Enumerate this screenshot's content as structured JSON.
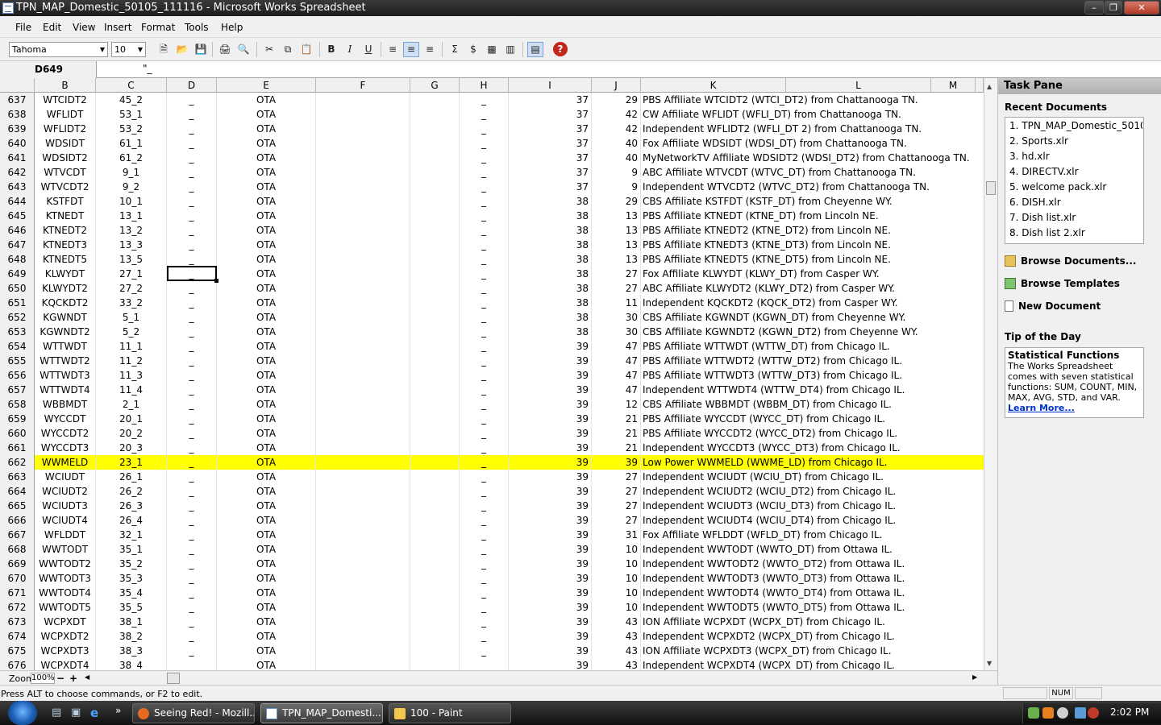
{
  "window": {
    "title": "TPN_MAP_Domestic_50105_111116 - Microsoft Works Spreadsheet"
  },
  "menu": [
    "File",
    "Edit",
    "View",
    "Insert",
    "Format",
    "Tools",
    "Help"
  ],
  "toolbar": {
    "font": "Tahoma",
    "size": "10"
  },
  "formula": {
    "cell_ref": "D649",
    "content": "\"_"
  },
  "columns": [
    "B",
    "C",
    "D",
    "E",
    "F",
    "G",
    "H",
    "I",
    "J",
    "K",
    "L",
    "M"
  ],
  "rows": [
    [
      "637",
      "WTCIDT2",
      "45_2",
      "_",
      "OTA",
      "_",
      "37",
      "29",
      "PBS Affiliate WTCIDT2 (WTCI_DT2) from Chattanooga TN."
    ],
    [
      "638",
      "WFLIDT",
      "53_1",
      "_",
      "OTA",
      "_",
      "37",
      "42",
      "CW Affiliate WFLIDT (WFLI_DT) from Chattanooga TN."
    ],
    [
      "639",
      "WFLIDT2",
      "53_2",
      "_",
      "OTA",
      "_",
      "37",
      "42",
      "Independent WFLIDT2 (WFLI_DT 2) from Chattanooga TN."
    ],
    [
      "640",
      "WDSIDT",
      "61_1",
      "_",
      "OTA",
      "_",
      "37",
      "40",
      "Fox Affiliate WDSIDT (WDSI_DT) from Chattanooga TN."
    ],
    [
      "641",
      "WDSIDT2",
      "61_2",
      "_",
      "OTA",
      "_",
      "37",
      "40",
      "MyNetworkTV Affiliate WDSIDT2 (WDSI_DT2) from Chattanooga TN."
    ],
    [
      "642",
      "WTVCDT",
      "9_1",
      "_",
      "OTA",
      "_",
      "37",
      "9",
      "ABC Affiliate WTVCDT (WTVC_DT) from Chattanooga TN."
    ],
    [
      "643",
      "WTVCDT2",
      "9_2",
      "_",
      "OTA",
      "_",
      "37",
      "9",
      "Independent WTVCDT2 (WTVC_DT2) from Chattanooga TN."
    ],
    [
      "644",
      "KSTFDT",
      "10_1",
      "_",
      "OTA",
      "_",
      "38",
      "29",
      "CBS Affiliate KSTFDT (KSTF_DT) from Cheyenne WY."
    ],
    [
      "645",
      "KTNEDT",
      "13_1",
      "_",
      "OTA",
      "_",
      "38",
      "13",
      "PBS Affiliate KTNEDT (KTNE_DT) from Lincoln NE."
    ],
    [
      "646",
      "KTNEDT2",
      "13_2",
      "_",
      "OTA",
      "_",
      "38",
      "13",
      "PBS Affiliate KTNEDT2 (KTNE_DT2) from Lincoln NE."
    ],
    [
      "647",
      "KTNEDT3",
      "13_3",
      "_",
      "OTA",
      "_",
      "38",
      "13",
      "PBS Affiliate KTNEDT3 (KTNE_DT3) from Lincoln NE."
    ],
    [
      "648",
      "KTNEDT5",
      "13_5",
      "_",
      "OTA",
      "_",
      "38",
      "13",
      "PBS Affiliate KTNEDT5 (KTNE_DT5) from Lincoln NE."
    ],
    [
      "649",
      "KLWYDT",
      "27_1",
      "_",
      "OTA",
      "_",
      "38",
      "27",
      "Fox Affiliate KLWYDT (KLWY_DT) from Casper WY."
    ],
    [
      "650",
      "KLWYDT2",
      "27_2",
      "_",
      "OTA",
      "_",
      "38",
      "27",
      "ABC Affiliate KLWYDT2 (KLWY_DT2) from Casper WY."
    ],
    [
      "651",
      "KQCKDT2",
      "33_2",
      "_",
      "OTA",
      "_",
      "38",
      "11",
      "Independent KQCKDT2 (KQCK_DT2) from Casper WY."
    ],
    [
      "652",
      "KGWNDT",
      "5_1",
      "_",
      "OTA",
      "_",
      "38",
      "30",
      "CBS Affiliate KGWNDT (KGWN_DT) from Cheyenne WY."
    ],
    [
      "653",
      "KGWNDT2",
      "5_2",
      "_",
      "OTA",
      "_",
      "38",
      "30",
      "CBS Affiliate KGWNDT2 (KGWN_DT2) from Cheyenne WY."
    ],
    [
      "654",
      "WTTWDT",
      "11_1",
      "_",
      "OTA",
      "_",
      "39",
      "47",
      "PBS Affiliate WTTWDT (WTTW_DT) from Chicago IL."
    ],
    [
      "655",
      "WTTWDT2",
      "11_2",
      "_",
      "OTA",
      "_",
      "39",
      "47",
      "PBS Affiliate WTTWDT2 (WTTW_DT2) from Chicago IL."
    ],
    [
      "656",
      "WTTWDT3",
      "11_3",
      "_",
      "OTA",
      "_",
      "39",
      "47",
      "PBS Affiliate WTTWDT3 (WTTW_DT3) from Chicago IL."
    ],
    [
      "657",
      "WTTWDT4",
      "11_4",
      "_",
      "OTA",
      "_",
      "39",
      "47",
      "Independent WTTWDT4 (WTTW_DT4) from Chicago IL."
    ],
    [
      "658",
      "WBBMDT",
      "2_1",
      "_",
      "OTA",
      "_",
      "39",
      "12",
      "CBS Affiliate WBBMDT (WBBM_DT) from Chicago IL."
    ],
    [
      "659",
      "WYCCDT",
      "20_1",
      "_",
      "OTA",
      "_",
      "39",
      "21",
      "PBS Affiliate WYCCDT (WYCC_DT) from Chicago IL."
    ],
    [
      "660",
      "WYCCDT2",
      "20_2",
      "_",
      "OTA",
      "_",
      "39",
      "21",
      "PBS Affiliate WYCCDT2 (WYCC_DT2) from Chicago IL."
    ],
    [
      "661",
      "WYCCDT3",
      "20_3",
      "_",
      "OTA",
      "_",
      "39",
      "21",
      "Independent WYCCDT3 (WYCC_DT3) from Chicago IL."
    ],
    [
      "662",
      "WWMELD",
      "23_1",
      "_",
      "OTA",
      "_",
      "39",
      "39",
      "Low Power WWMELD (WWME_LD) from Chicago IL."
    ],
    [
      "663",
      "WCIUDT",
      "26_1",
      "_",
      "OTA",
      "_",
      "39",
      "27",
      "Independent WCIUDT (WCIU_DT) from Chicago IL."
    ],
    [
      "664",
      "WCIUDT2",
      "26_2",
      "_",
      "OTA",
      "_",
      "39",
      "27",
      "Independent WCIUDT2 (WCIU_DT2) from Chicago IL."
    ],
    [
      "665",
      "WCIUDT3",
      "26_3",
      "_",
      "OTA",
      "_",
      "39",
      "27",
      "Independent WCIUDT3 (WCIU_DT3) from Chicago IL."
    ],
    [
      "666",
      "WCIUDT4",
      "26_4",
      "_",
      "OTA",
      "_",
      "39",
      "27",
      "Independent WCIUDT4 (WCIU_DT4) from Chicago IL."
    ],
    [
      "667",
      "WFLDDT",
      "32_1",
      "_",
      "OTA",
      "_",
      "39",
      "31",
      "Fox Affiliate WFLDDT (WFLD_DT) from Chicago IL."
    ],
    [
      "668",
      "WWTODT",
      "35_1",
      "_",
      "OTA",
      "_",
      "39",
      "10",
      "Independent WWTODT (WWTO_DT) from Ottawa IL."
    ],
    [
      "669",
      "WWTODT2",
      "35_2",
      "_",
      "OTA",
      "_",
      "39",
      "10",
      "Independent WWTODT2 (WWTO_DT2) from Ottawa IL."
    ],
    [
      "670",
      "WWTODT3",
      "35_3",
      "_",
      "OTA",
      "_",
      "39",
      "10",
      "Independent WWTODT3 (WWTO_DT3) from Ottawa IL."
    ],
    [
      "671",
      "WWTODT4",
      "35_4",
      "_",
      "OTA",
      "_",
      "39",
      "10",
      "Independent WWTODT4 (WWTO_DT4) from Ottawa IL."
    ],
    [
      "672",
      "WWTODT5",
      "35_5",
      "_",
      "OTA",
      "_",
      "39",
      "10",
      "Independent WWTODT5 (WWTO_DT5) from Ottawa IL."
    ],
    [
      "673",
      "WCPXDT",
      "38_1",
      "_",
      "OTA",
      "_",
      "39",
      "43",
      "ION Affiliate WCPXDT (WCPX_DT) from Chicago IL."
    ],
    [
      "674",
      "WCPXDT2",
      "38_2",
      "_",
      "OTA",
      "_",
      "39",
      "43",
      "Independent WCPXDT2 (WCPX_DT) from Chicago IL."
    ],
    [
      "675",
      "WCPXDT3",
      "38_3",
      "_",
      "OTA",
      "_",
      "39",
      "43",
      "ION Affiliate WCPXDT3 (WCPX_DT) from Chicago IL."
    ],
    [
      "676",
      "WCPXDT4",
      "38_4",
      "_",
      "OTA",
      "_",
      "39",
      "43",
      "Independent WCPXDT4 (WCPX_DT) from Chicago IL."
    ]
  ],
  "highlight_row": "662",
  "highlight_color": "#ffff00",
  "selected_cell": "D649",
  "zoom": {
    "label": "Zoom",
    "value": "100%"
  },
  "taskpane": {
    "title": "Task Pane",
    "recent_title": "Recent Documents",
    "recent": [
      "1. TPN_MAP_Domestic_5010...",
      "2. Sports.xlr",
      "3. hd.xlr",
      "4. DIRECTV.xlr",
      "5. welcome pack.xlr",
      "6. DISH.xlr",
      "7. Dish list.xlr",
      "8. Dish list 2.xlr"
    ],
    "browse_documents": "Browse Documents...",
    "browse_templates": "Browse Templates",
    "new_document": "New Document",
    "tip_title": "Tip of the Day",
    "tip_heading": "Statistical Functions",
    "tip_body": "The Works Spreadsheet comes with seven statistical functions: SUM, COUNT, MIN, MAX, AVG, STD, and VAR.",
    "tip_link": "Learn More..."
  },
  "status": {
    "message": "Press ALT to choose commands, or F2 to edit.",
    "num": "NUM"
  },
  "taskbar": {
    "tasks": [
      "Seeing Red! - Mozill...",
      "TPN_MAP_Domesti...",
      "100 - Paint"
    ],
    "clock": "2:02 PM"
  }
}
